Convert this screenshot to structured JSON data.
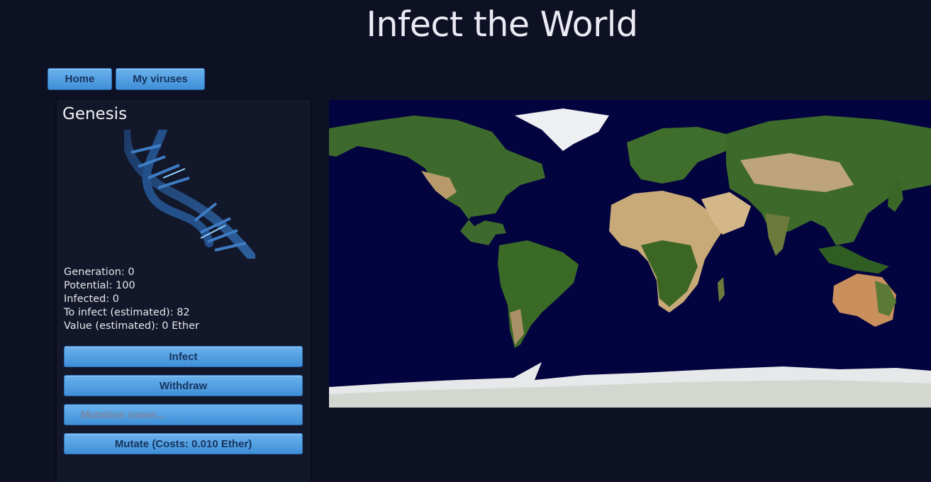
{
  "title": "Infect the World",
  "nav": {
    "home_label": "Home",
    "my_viruses_label": "My viruses"
  },
  "virus": {
    "name": "Genesis",
    "stats": {
      "generation": "Generation: 0",
      "potential": "Potential: 100",
      "infected": "Infected: 0",
      "to_infect": "To infect (estimated): 82",
      "value": "Value (estimated): 0 Ether"
    },
    "image_icon": "dna-helix-icon"
  },
  "actions": {
    "infect_label": "Infect",
    "withdraw_label": "Withdraw",
    "mutation_placeholder": "Mutation name...",
    "mutation_value": "",
    "mutate_label": "Mutate (Costs: 0.010 Ether)"
  },
  "map": {
    "image": "world-map-satellite",
    "ocean_color": "#03033f",
    "land_color": "#3f6a2a",
    "desert_color": "#c9ad7f",
    "ice_color": "#e9ecef"
  },
  "colors": {
    "background": "#0e1124",
    "panel": "#13172a",
    "button": "#4f9fe2",
    "button_text": "#17335e"
  }
}
